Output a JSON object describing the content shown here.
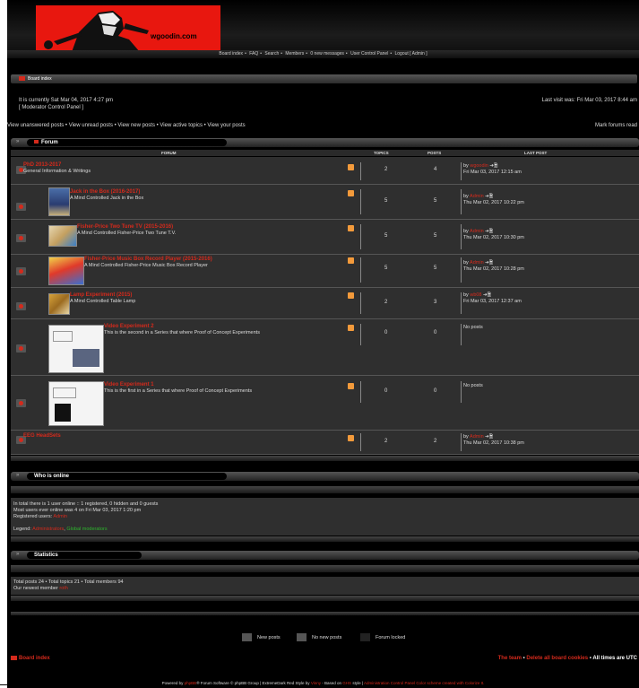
{
  "header": {
    "logo_text": "wgoodin.com"
  },
  "navbar": {
    "items": [
      "Board index",
      "FAQ",
      "Search",
      "Members",
      "0 new messages",
      "User Control Panel",
      "Logout [ Admin ]"
    ],
    "sep": "•"
  },
  "breadcrumb": {
    "label": "Board index"
  },
  "info": {
    "current_time": "It is currently Sat Mar 04, 2017 4:27 pm",
    "mcp": "[ Moderator Control Panel ]",
    "last_visit": "Last visit was: Fri Mar 03, 2017 8:44 am",
    "links": "View unanswered posts • View unread posts • View new posts • View active topics • View your posts",
    "mark_read": "Mark forums read"
  },
  "forum": {
    "title": "Forum",
    "columns": {
      "forum": "FORUM",
      "topics": "TOPICS",
      "posts": "POSTS",
      "last_post": "LAST POST"
    },
    "rows": [
      {
        "title": "PhD 2013-2017",
        "desc": "General Information & Writings",
        "topics": "2",
        "posts": "4",
        "by": "by",
        "user": "wgoodin",
        "date": "Fri Mar 03, 2017 12:15 am"
      },
      {
        "title": "Jack in the Box (2016-2017)",
        "desc": "A Mind Controlled Jack in the Box",
        "topics": "5",
        "posts": "5",
        "by": "by",
        "user": "Admin",
        "date": "Thu Mar 02, 2017 10:22 pm"
      },
      {
        "title": "Fisher-Price Two Tune TV (2015-2016)",
        "desc": "A Mind Controlled Fisher-Price Two Tune T.V.",
        "topics": "5",
        "posts": "5",
        "by": "by",
        "user": "Admin",
        "date": "Thu Mar 02, 2017 10:30 pm"
      },
      {
        "title": "Fisher-Price Music Box Record Player (2015-2016)",
        "desc": "A Mind Controlled Fisher-Price Music Box Record Player",
        "topics": "5",
        "posts": "5",
        "by": "by",
        "user": "Admin",
        "date": "Thu Mar 02, 2017 10:28 pm"
      },
      {
        "title": "Lamp Experiment (2015)",
        "desc": "A Mind Controlled Table Lamp",
        "topics": "2",
        "posts": "3",
        "by": "by",
        "user": "wb08",
        "date": "Fri Mar 03, 2017 12:37 am"
      },
      {
        "title": "Video Experiment 2",
        "desc": "This is the second in a Series that where Proof of Concept Experiments",
        "topics": "0",
        "posts": "0",
        "no_posts": "No posts"
      },
      {
        "title": "Video Experiment 1",
        "desc": "This is the first in a Series that where Proof of Concept Experiments",
        "topics": "0",
        "posts": "0",
        "no_posts": "No posts"
      },
      {
        "title": "EEG HeadSets",
        "desc": "",
        "topics": "2",
        "posts": "2",
        "by": "by",
        "user": "Admin",
        "date": "Thu Mar 02, 2017 10:38 pm"
      }
    ]
  },
  "who_online": {
    "title": "Who is online",
    "line1": "In total there is 1 user online :: 1 registered, 0 hidden and 0 guests",
    "line2": "Most users ever online was 4 on Fri Mar 03, 2017 1:20 pm",
    "registered_label": "Registered users:",
    "registered_user": "Admin",
    "legend_label": "Legend:",
    "legend_admin": "Administrators",
    "legend_mods": "Global moderators"
  },
  "statistics": {
    "title": "Statistics",
    "line1": "Total posts 24 • Total topics 21 • Total members 94",
    "newest_label": "Our newest member",
    "newest_user": "roth"
  },
  "legend_icons": {
    "new_posts": "New posts",
    "no_new_posts": "No new posts",
    "forum_locked": "Forum locked"
  },
  "bottom": {
    "board_index": "Board index",
    "team": "The team",
    "delete_cookies": "Delete all board cookies",
    "times": "All times are UTC"
  },
  "footer": {
    "powered_by": "Powered by",
    "phpbb": "phpBB",
    "rest1": "® Forum Software © phpBB Group | ExtremeDark Red Style by",
    "vinny": "Vinny",
    "based": "- Based on",
    "ghs": "GHS",
    "style": "style |",
    "acp": "Administration Control Panel",
    "colorize": "Color scheme created with Colorize It."
  },
  "colors": {
    "accent": "#d42a1c",
    "green": "#2db52d",
    "rss": "#f39a3b"
  }
}
